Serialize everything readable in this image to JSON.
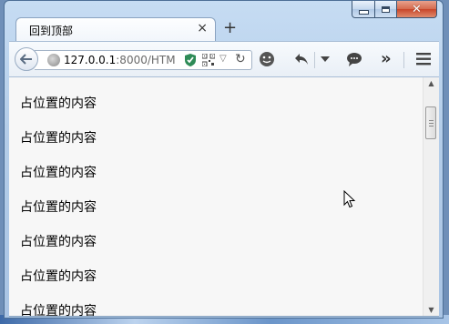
{
  "window": {
    "tab_title": "回到顶部",
    "tab_close": "×",
    "new_tab": "+"
  },
  "urlbar": {
    "host": "127.0.0.1",
    "path": ":8000/HTM",
    "dropdown": "▽",
    "reload": "↻"
  },
  "toolbar": {
    "overflow": "»",
    "menu": "≡"
  },
  "content": {
    "items": [
      "占位置的内容",
      "占位置的内容",
      "占位置的内容",
      "占位置的内容",
      "占位置的内容",
      "占位置的内容",
      "占位置的内容"
    ]
  },
  "colors": {
    "accent": "#2e8b57",
    "titlebar": "#b4cde9",
    "close": "#c8462a"
  }
}
